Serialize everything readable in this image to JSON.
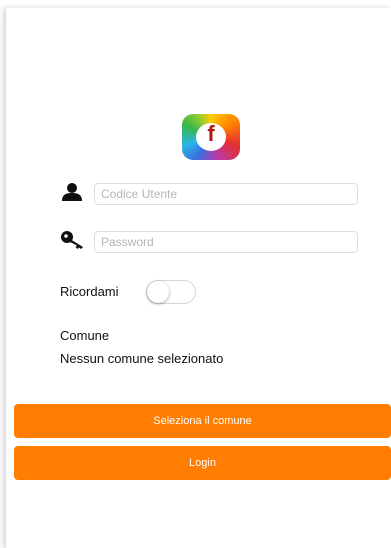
{
  "login_form": {
    "user_code_placeholder": "Codice Utente",
    "password_placeholder": "Password",
    "remember_me_label": "Ricordami",
    "remember_me_on": false
  },
  "comune": {
    "heading": "Comune",
    "value": "Nessun comune selezionato"
  },
  "buttons": {
    "select_comune": "Seleziona il comune",
    "login": "Login"
  },
  "icons": {
    "logo": "app-logo",
    "user": "user-icon",
    "password": "key-icon"
  },
  "colors": {
    "accent": "#ff7d00",
    "logo_letter": "#b01818"
  }
}
